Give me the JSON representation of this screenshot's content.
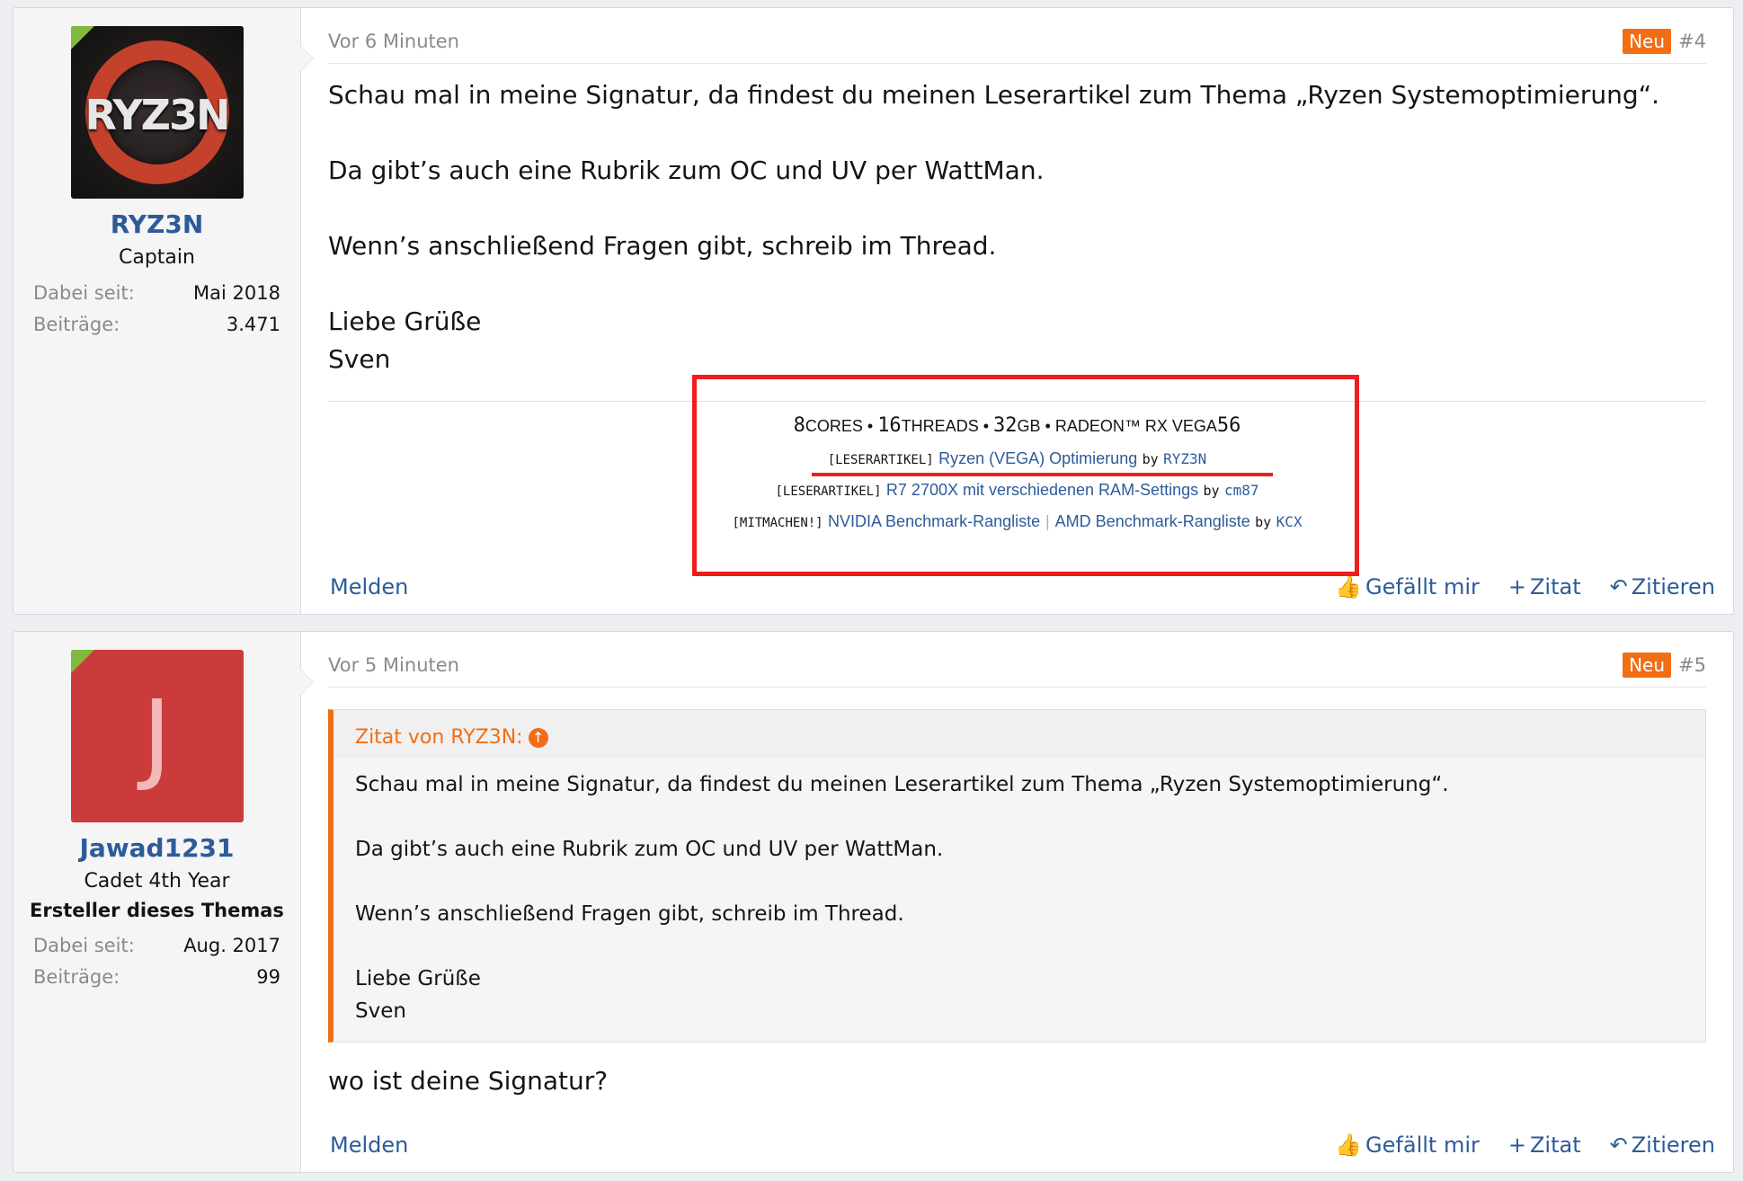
{
  "posts": [
    {
      "time": "Vor 6 Minuten",
      "badge": "Neu",
      "number": "#4",
      "user": {
        "name": "RYZ3N",
        "avatar_text": "RYZ3N",
        "title": "Captain",
        "stats": [
          {
            "label": "Dabei seit:",
            "value": "Mai 2018"
          },
          {
            "label": "Beiträge:",
            "value": "3.471"
          }
        ]
      },
      "body": [
        "Schau mal in meine Signatur, da findest du meinen Leserartikel zum Thema „Ryzen Systemoptimierung“.",
        "Da gibt’s auch eine Rubrik zum OC und UV per WattMan.",
        "Wenn’s anschließend Fragen gibt, schreib im Thread.",
        "Liebe Grüße",
        "Sven"
      ],
      "signature": {
        "line1": {
          "n1": "8",
          "w1": "CORES",
          "sep": " • ",
          "n2": "16",
          "w2": "THREADS",
          "n3": "32",
          "w3": "GB",
          "w4": "RADEON™ RX VEGA",
          "n4": "56"
        },
        "line2": {
          "tag": "[LESERARTIKEL]",
          "link": "Ryzen (VEGA) Optimierung",
          "by": "by",
          "author": "RYZ3N"
        },
        "line3": {
          "tag": "[LESERARTIKEL]",
          "link": "R7 2700X mit verschiedenen RAM-Settings",
          "by": "by",
          "author": "cm87"
        },
        "line4": {
          "tag": "[MITMACHEN!]",
          "link1": "NVIDIA Benchmark-Rangliste",
          "divider": "|",
          "link2": "AMD Benchmark-Rangliste",
          "by": "by",
          "author": "KCX"
        }
      },
      "footer": {
        "report": "Melden",
        "like": "Gefällt mir",
        "quote": "Zitat",
        "reply": "Zitieren"
      }
    },
    {
      "time": "Vor 5 Minuten",
      "badge": "Neu",
      "number": "#5",
      "user": {
        "name": "Jawad1231",
        "avatar_letter": "J",
        "title": "Cadet 4th Year",
        "banner": "Ersteller dieses Themas",
        "stats": [
          {
            "label": "Dabei seit:",
            "value": "Aug. 2017"
          },
          {
            "label": "Beiträge:",
            "value": "99"
          }
        ]
      },
      "quote": {
        "head": "Zitat von RYZ3N:",
        "body": [
          "Schau mal in meine Signatur, da findest du meinen Leserartikel zum Thema „Ryzen Systemoptimierung“.",
          "Da gibt’s auch eine Rubrik zum OC und UV per WattMan.",
          "Wenn’s anschließend Fragen gibt, schreib im Thread.",
          "Liebe Grüße",
          "Sven"
        ]
      },
      "reply": "wo ist deine Signatur?",
      "footer": {
        "report": "Melden",
        "like": "Gefällt mir",
        "quote": "Zitat",
        "reply": "Zitieren"
      }
    }
  ],
  "colors": {
    "accent": "#f26e15",
    "link": "#2d5b9a",
    "highlight": "#f01c1c",
    "online": "#7fba3d"
  }
}
